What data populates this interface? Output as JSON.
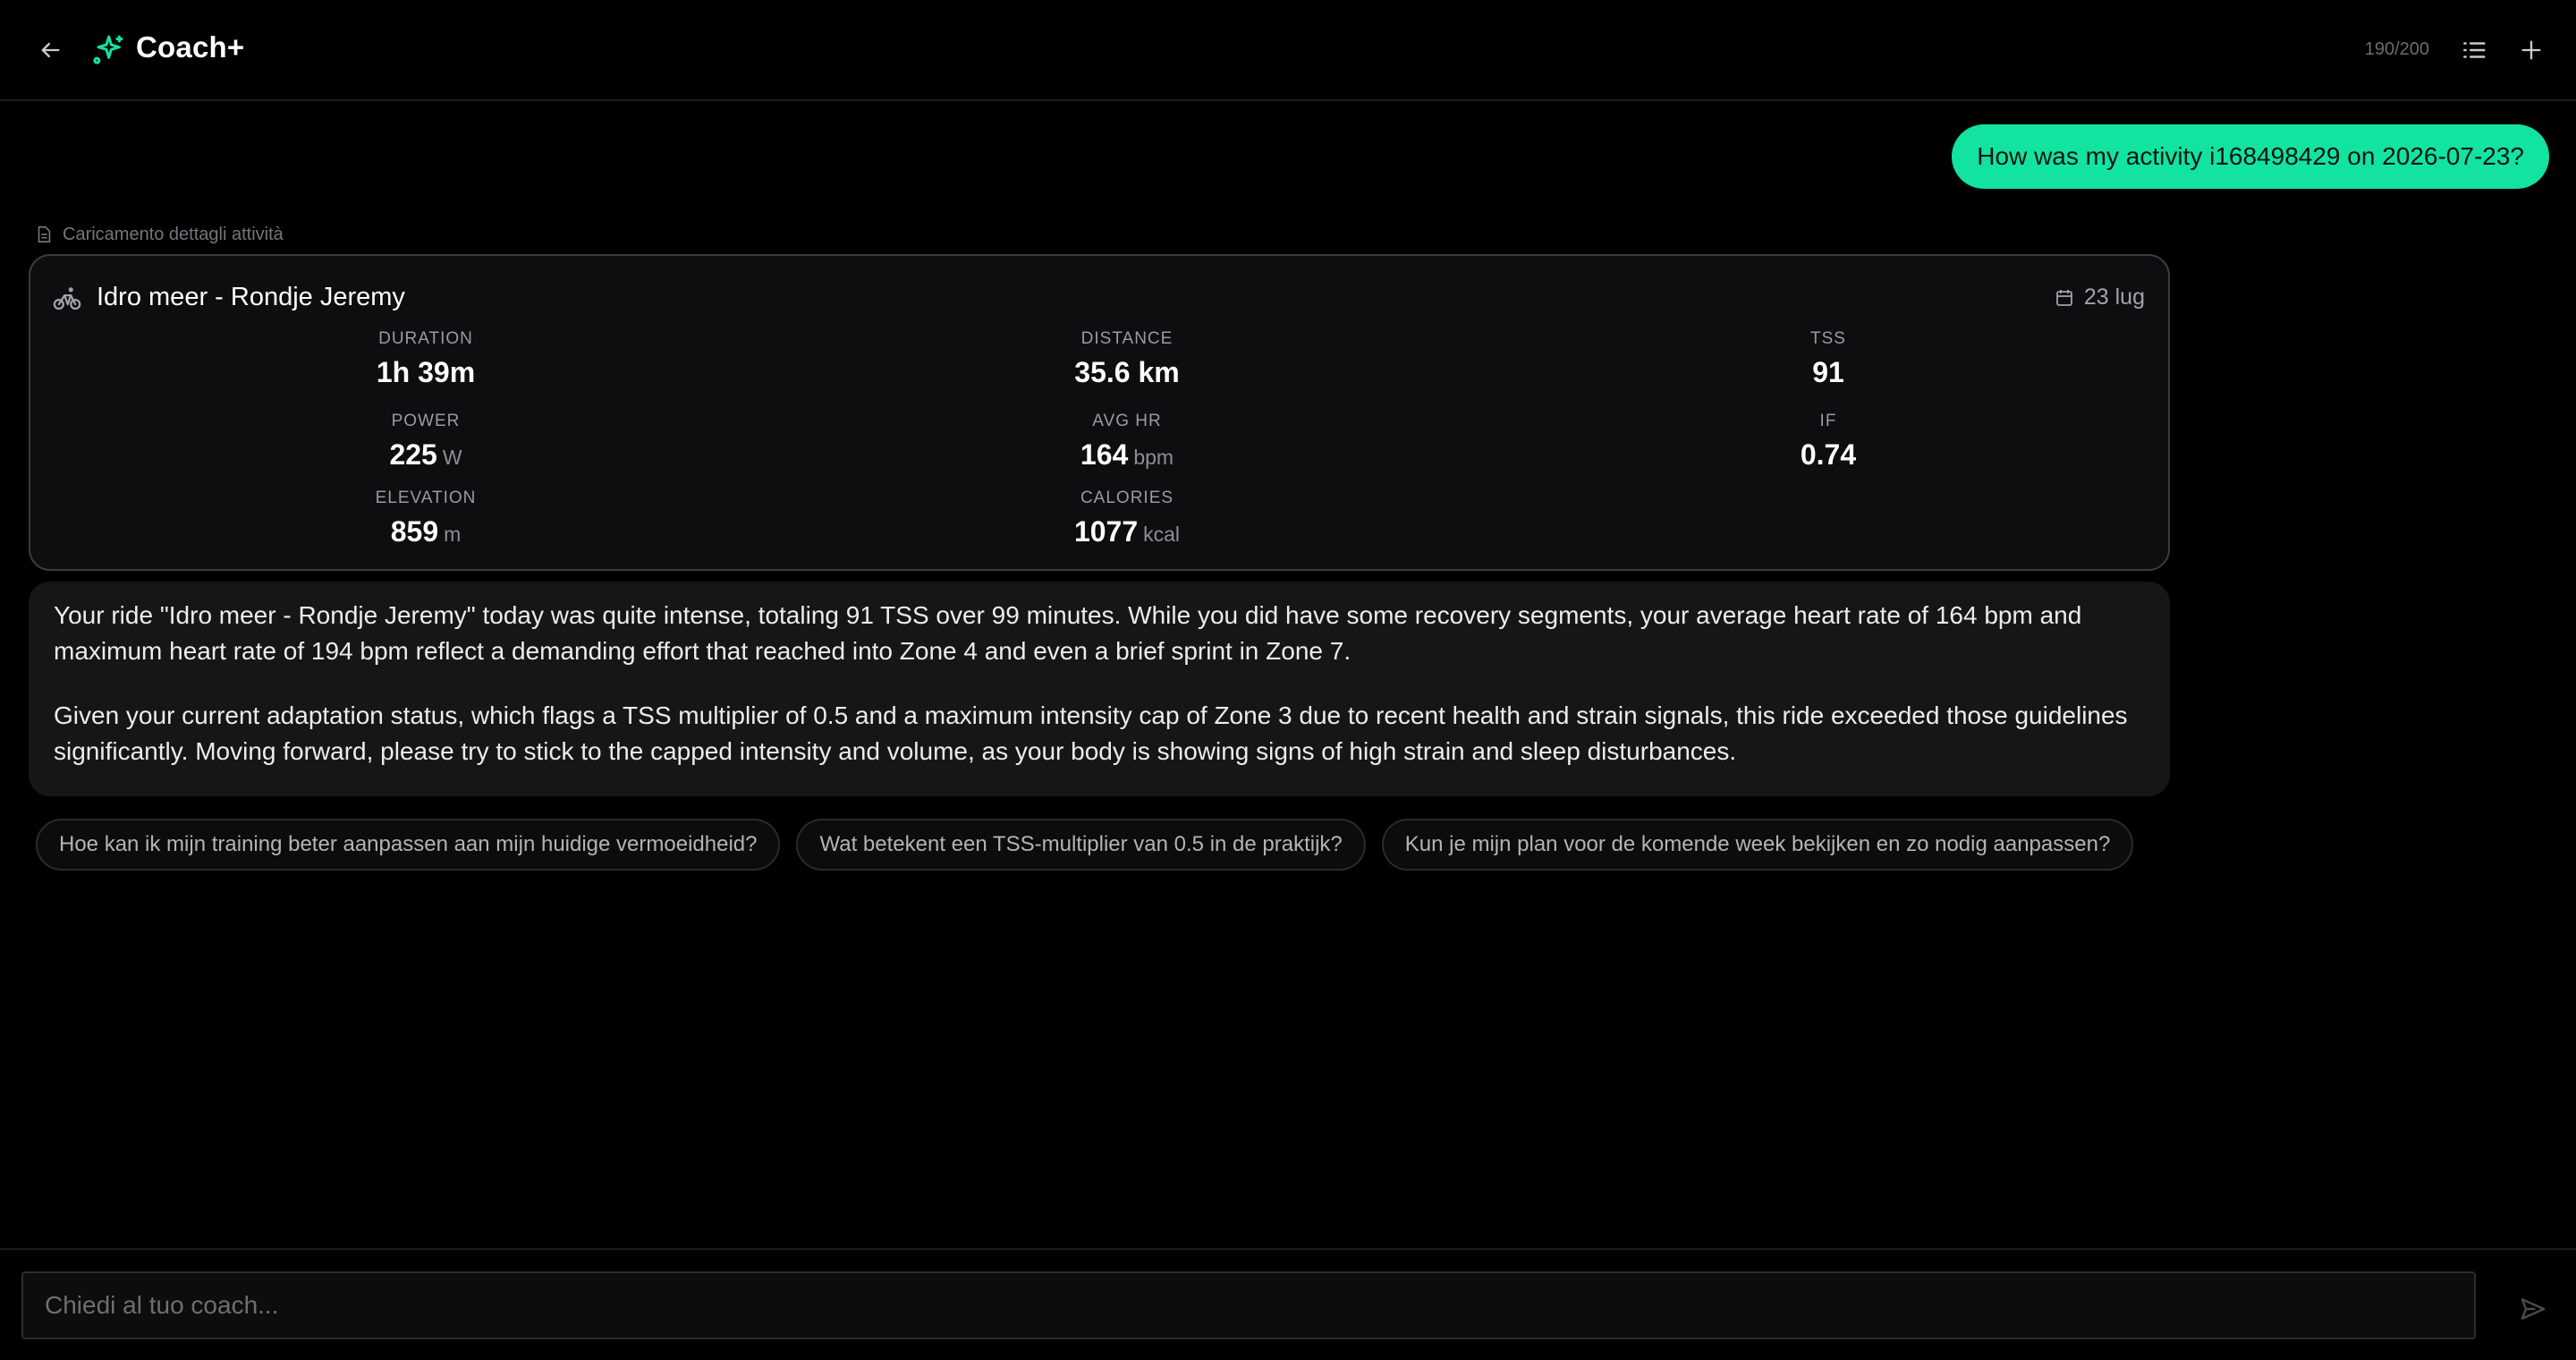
{
  "header": {
    "title": "Coach+",
    "message_count": "190/200",
    "accent_color": "#12e3a0"
  },
  "conversation": {
    "user_message": "How was my activity i168498429 on 2026-07-23?",
    "tool_status": "Caricamento dettagli attività",
    "activity_card": {
      "title": "Idro meer - Rondje Jeremy",
      "date": "23 lug",
      "icon": "bike-icon",
      "stats": {
        "duration": {
          "label": "DURATION",
          "value": "1h 39m",
          "unit": ""
        },
        "distance": {
          "label": "DISTANCE",
          "value": "35.6 km",
          "unit": ""
        },
        "tss": {
          "label": "TSS",
          "value": "91",
          "unit": ""
        },
        "power": {
          "label": "POWER",
          "value": "225",
          "unit": "W"
        },
        "avg_hr": {
          "label": "AVG HR",
          "value": "164",
          "unit": "bpm"
        },
        "if": {
          "label": "IF",
          "value": "0.74",
          "unit": ""
        },
        "elevation": {
          "label": "ELEVATION",
          "value": "859",
          "unit": "m"
        },
        "calories": {
          "label": "CALORIES",
          "value": "1077",
          "unit": "kcal"
        }
      }
    },
    "assistant_message": {
      "paragraph_1": "Your ride \"Idro meer - Rondje Jeremy\" today was quite intense, totaling 91 TSS over 99 minutes. While you did have some recovery segments, your average heart rate of 164 bpm and maximum heart rate of 194 bpm reflect a demanding effort that reached into Zone 4 and even a brief sprint in Zone 7.",
      "paragraph_2": "Given your current adaptation status, which flags a TSS multiplier of 0.5 and a maximum intensity cap of Zone 3 due to recent health and strain signals, this ride exceeded those guidelines significantly. Moving forward, please try to stick to the capped intensity and volume, as your body is showing signs of high strain and sleep disturbances."
    },
    "suggestions": [
      "Hoe kan ik mijn training beter aanpassen aan mijn huidige vermoeidheid?",
      "Wat betekent een TSS-multiplier van 0.5 in de praktijk?",
      "Kun je mijn plan voor de komende week bekijken en zo nodig aanpassen?"
    ]
  },
  "composer": {
    "placeholder": "Chiedi al tuo coach..."
  }
}
